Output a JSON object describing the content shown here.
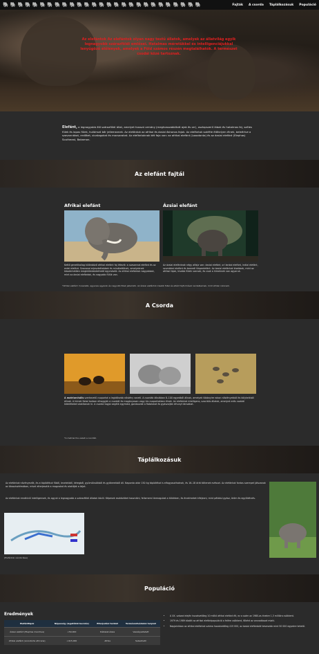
{
  "nav": {
    "herd_glyphs": [
      "🐘",
      "🐘",
      "🐘",
      "🐘",
      "🐘",
      "🐘",
      "🐘",
      "🐘",
      "🐘",
      "🐘",
      "🐘",
      "🐘",
      "🐘",
      "🐘",
      "🐘",
      "🐘",
      "🐘",
      "🐘",
      "🐘",
      "🐘",
      "🐘",
      "🐘",
      "🐘",
      "🐘",
      "🐘",
      "🐘",
      "🐘"
    ],
    "links": [
      "Fajták",
      "A csorda",
      "Táplálkozásuk",
      "Populáció"
    ]
  },
  "hero": {
    "text": "Az elefántok Az elefántok olyan nagy testű állatok, amelyek az állatvilág egyik legnagyobb szárazföldi emlősei. Hatalmas méretükkel és intelligenciájukkal lenyűgöző élőlények, amelyek a Föld számos részén megtalálhatók. A természet csodái közé tartoznak."
  },
  "intro": {
    "lead": "Elefánt,",
    "text": " a legnagyobb élő szárazföldi állat, amelyet hosszú ormány (meghosszabbított ajak és orr), oszlopszerű lábak és hatalmas fej, széles fülek és lapos fülek, hullámzó bőr jellemeznek. Az elefántok az afrikai és ázsiai őshonos fajok. Az elefántok sokféle élőhelyen élnek, beleértve a szavannákat, erdőket, sivatagokat és mocsarakat. Az elefántoknak két faja van: az afrikai elefánt (Loxodonta) és az ázsiai elefánt (Elephas) Southeast, Bakamon."
  },
  "species": {
    "title": "Az elefánt fajtái",
    "african": {
      "title": "Afrikai elefánt",
      "text": "Kettő genetikailag különböző afrikai elefánt faj létezik: a szavannai elefánt és az erdei elefánt. Szavanai erjesztettebbek és mindkettőnek, amelyeknek köszönhetően megkülönböztethető egymástól. Az afrikai elefántok nagyobbak, mint az ázsiai elefántok, és nagyobb fülük van."
    },
    "asian": {
      "title": "Ázsiai elefánt",
      "text": "Az ázsiai elefántnak négy alfaja van: ázsiai elefánt, srí lankai elefánt, indiai elefánt, szumátrai elefánt és borneói törpeelefánt. Az ázsiai elefántok kisebbek, mint az afrikai fajok, kisebb füleik vannak, és csak a hímeknek van agyaruk."
    },
    "note": "*Afrikai elefánt: hosszabb, egyenes agyarak és nagyobb fülek jellemzik. Az ázsiai elefántok kisebb füllel és eltérő fejformával rendelkeznek, mint afrikai rokonaik."
  },
  "herd": {
    "title": "A Csorda",
    "lead": "A matriarchális",
    "text": " szerkezetű csoportot a legidősebb nőstény vezeti. A csordák általában 8–100 egyedből állnak, amelyek többnyire rokon nőstényekből és kölykeikből állnak. A hímek fiatal korban elhagyják a csordát és magányosan vagy kis csoportokban élnek. Az elefántok intelligens, szociális állatok, amelyek erős családi kötelékeket alakítanak ki. A csorda tagjai segítik egymást, gondozzák a fiatalokat és gyászolják elhunyt társaikat.",
    "note": "*A matriarcha vezeti a csordát."
  },
  "food": {
    "title": "Táplálkozásuk",
    "text1": "Az elefántok növényevők, és a táplálékuk fűből, levelekből, kéregből, gyümölcsökből és gyökerekből áll. Naponta akár 150 kg táplálékot is elfogyaszthatnak, és 16–18 órát töltenek evéssel. Az elefántok fontos szerepet játszanak az ökoszisztémában, mivel elterjesztik a magvakat és alakítják a tájat.",
    "text2": "Az elefántok rendkívül intelligensek, és agyuk a legnagyobb a szárazföldi állatok közül. Képesek eszközöket használni, felismerni önmagukat a tükörben, és érzelmeket kifejezni, mint például gyász, öröm és együttérzés.",
    "map_caption": "(Elefántok vándorlása)"
  },
  "population": {
    "title": "Populáció",
    "table_title": "Eredmények",
    "headers": [
      "Elefántfajok",
      "Népesség (legutóbbi becslés)",
      "Elterjedési terület",
      "Természetvédelmi helyzet"
    ],
    "rows": [
      [
        "Ázsiai elefánt (Elephas maximus)",
        "<50,000",
        "Délkelet-Ázsia",
        "Veszélyeztetett"
      ],
      [
        "Afrikai elefánt (Loxodonta africana)",
        "<415,000",
        "Afrika",
        "Sebezhető"
      ]
    ],
    "facts": [
      "A XX. század elején hozzávetőleg 10 millió afrikai elefánt élt, ez a szám az 1980-as évekre 1,3 millióra csökkent.",
      "1979 és 1989 között az afrikai elefántpopuláció a felére csökkent, főként az orvvadászat miatt.",
      "Napjainkban az afrikai elefántok száma hozzávetőleg 415 000, az ázsiai elefántoké kevesebb mint 50 000 egyedre tehető."
    ]
  },
  "colors": {
    "hero_text": "#e02020",
    "table_header": "#1f2f3f"
  }
}
